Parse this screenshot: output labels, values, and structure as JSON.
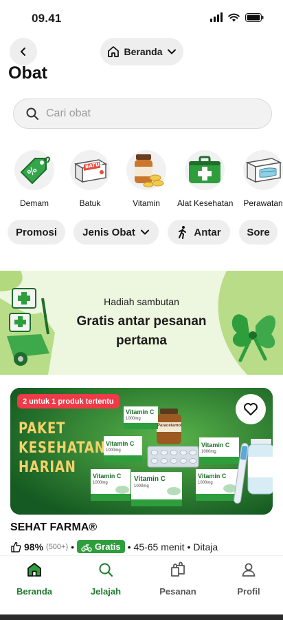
{
  "status": {
    "time": "09.41"
  },
  "header": {
    "location_label": "Beranda"
  },
  "page": {
    "title": "Obat"
  },
  "search": {
    "placeholder": "Cari obat"
  },
  "categories": [
    {
      "label": "Demam",
      "icon": "fever-tag-icon"
    },
    {
      "label": "Batuk",
      "icon": "cough-medicine-box-icon",
      "box_text": "BATUK"
    },
    {
      "label": "Vitamin",
      "icon": "vitamin-bottle-icon"
    },
    {
      "label": "Alat Kesehatan",
      "icon": "first-aid-kit-icon"
    },
    {
      "label": "Perawatan",
      "icon": "face-mask-box-icon"
    }
  ],
  "filters": [
    {
      "label": "Promosi"
    },
    {
      "label": "Jenis Obat",
      "has_dropdown": true
    },
    {
      "label": "Antar",
      "icon": "walking-person-icon"
    },
    {
      "label": "Sore"
    }
  ],
  "promo_banner": {
    "subtitle": "Hadiah sambutan",
    "title_line1": "Gratis antar pesanan",
    "title_line2": "pertama"
  },
  "product_card": {
    "badge": "2 untuk 1 produk tertentu",
    "headline_line1": "PAKET",
    "headline_line2": "KESEHATAN",
    "headline_line3": "HARIAN",
    "box_label": "Vitamin C",
    "box_dose": "1000mg",
    "bottle_label": "Paracetamol"
  },
  "merchant": {
    "name": "SEHAT FARMA®",
    "rating": "98%",
    "reviews": "(500+)",
    "delivery_badge": "Gratis",
    "eta": "45-65 menit",
    "extra": "Ditaja",
    "separator": "•"
  },
  "bottom_nav": [
    {
      "label": "Beranda",
      "icon": "home-icon",
      "active": true
    },
    {
      "label": "Jelajah",
      "icon": "search-icon",
      "active": true
    },
    {
      "label": "Pesanan",
      "icon": "bags-icon",
      "active": false
    },
    {
      "label": "Profil",
      "icon": "profile-icon",
      "active": false
    }
  ],
  "colors": {
    "brand_green": "#2e9e3d",
    "nav_active": "#1f7a2e",
    "nav_inactive": "#555555",
    "badge_red": "#ef3a47"
  }
}
